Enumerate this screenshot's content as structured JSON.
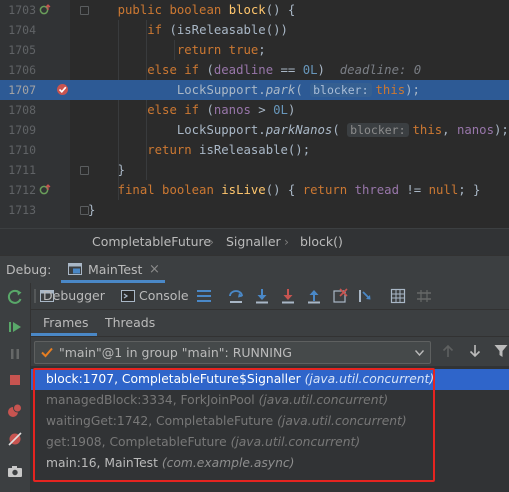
{
  "editor": {
    "lines": [
      {
        "num": "1703"
      },
      {
        "num": "1704"
      },
      {
        "num": "1705"
      },
      {
        "num": "1706"
      },
      {
        "num": "1707"
      },
      {
        "num": "1708"
      },
      {
        "num": "1709"
      },
      {
        "num": "1710"
      },
      {
        "num": "1711"
      },
      {
        "num": "1712"
      },
      {
        "num": "1713"
      }
    ],
    "inline_value": "deadline: 0",
    "param_hint": "blocker:"
  },
  "breadcrumb": {
    "items": [
      "CompletableFuture",
      "Signaller",
      "block()"
    ]
  },
  "debug": {
    "label": "Debug:",
    "session_tab": "MainTest",
    "tabs": {
      "debugger": "Debugger",
      "console": "Console"
    },
    "subtabs": {
      "frames": "Frames",
      "threads": "Threads"
    },
    "thread_selector": "\"main\"@1 in group \"main\": RUNNING",
    "frames": [
      {
        "method": "block:1707, CompletableFuture$Signaller",
        "pkg": "(java.util.concurrent)"
      },
      {
        "method": "managedBlock:3334, ForkJoinPool",
        "pkg": "(java.util.concurrent)"
      },
      {
        "method": "waitingGet:1742, CompletableFuture",
        "pkg": "(java.util.concurrent)"
      },
      {
        "method": "get:1908, CompletableFuture",
        "pkg": "(java.util.concurrent)"
      },
      {
        "method": "main:16, MainTest",
        "pkg": "(com.example.async)"
      }
    ]
  },
  "colors": {
    "highlight_line": "#2d5a95",
    "selected_frame": "#2f65ca",
    "annotation_box": "#e52420",
    "keyword": "#cc7832",
    "method": "#ffc66d"
  }
}
